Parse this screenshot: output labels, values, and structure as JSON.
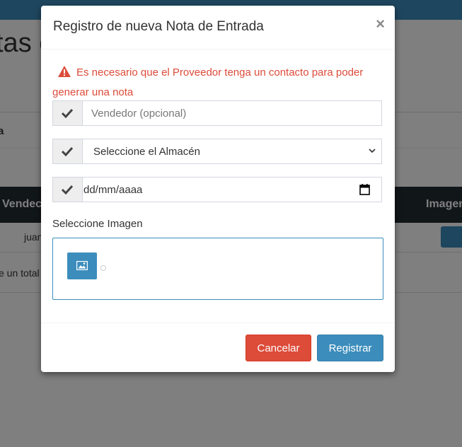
{
  "background": {
    "page_title": "tas c",
    "box_title": "a",
    "table_headers": [
      "Vendec",
      "Imagen"
    ],
    "first_cell": "juan",
    "total_text": "e un total"
  },
  "modal": {
    "title": "Registro de nueva Nota de Entrada",
    "close_label": "×",
    "alert_line1": "Es necesario que el Proveedor tenga un contacto para poder",
    "alert_line2": "generar una nota",
    "vendor_placeholder": "Vendedor (opcional)",
    "warehouse_selected": "Seleccione el Almacén",
    "date_placeholder": "dd/mm/aaaa",
    "image_label": "Seleccione Imagen",
    "cancel_label": "Cancelar",
    "submit_label": "Registrar"
  },
  "colors": {
    "danger": "#dd4b39",
    "primary": "#3c8dbc",
    "topbar": "#3c8dbc",
    "table_header": "#222d32"
  },
  "icons": [
    "warning-icon",
    "check-icon",
    "chevron-down-icon",
    "calendar-icon",
    "image-icon",
    "close-icon"
  ]
}
